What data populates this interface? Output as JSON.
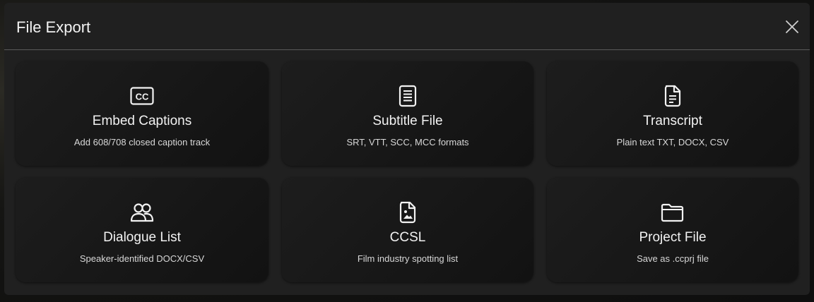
{
  "dialog": {
    "title": "File Export",
    "close_icon": "close-icon"
  },
  "options": [
    {
      "icon": "closed-captions-icon",
      "title": "Embed Captions",
      "description": "Add 608/708 closed caption track"
    },
    {
      "icon": "subtitle-document-icon",
      "title": "Subtitle File",
      "description": "SRT, VTT, SCC, MCC formats"
    },
    {
      "icon": "transcript-document-icon",
      "title": "Transcript",
      "description": "Plain text TXT, DOCX, CSV"
    },
    {
      "icon": "users-icon",
      "title": "Dialogue List",
      "description": "Speaker-identified DOCX/CSV"
    },
    {
      "icon": "image-document-icon",
      "title": "CCSL",
      "description": "Film industry spotting list"
    },
    {
      "icon": "folder-icon",
      "title": "Project File",
      "description": "Save as .ccprj file"
    }
  ],
  "colors": {
    "dialog_bg": "#202020",
    "card_bg": "#1a1a1a",
    "text": "#f2f2f2",
    "divider": "#5b5b5b"
  }
}
